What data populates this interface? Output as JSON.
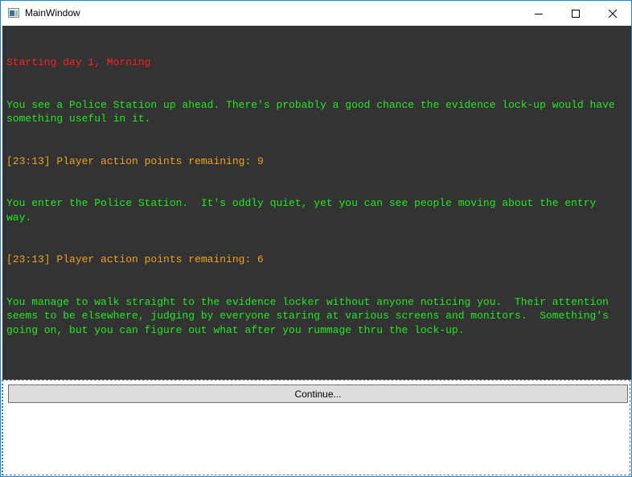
{
  "window": {
    "title": "MainWindow",
    "accent_color": "#1883d7"
  },
  "titlebar_buttons": [
    {
      "name": "minimize",
      "icon": "minimize-icon"
    },
    {
      "name": "maximize",
      "icon": "maximize-icon"
    },
    {
      "name": "close",
      "icon": "close-icon"
    }
  ],
  "log": {
    "background": "#333333",
    "lines": [
      {
        "type": "header",
        "color": "#ff2020",
        "text": "Starting day 1, Morning"
      },
      {
        "type": "narration",
        "color": "#22e822",
        "text": "You see a Police Station up ahead. There's probably a good chance the evidence lock-up would have something useful in it."
      },
      {
        "type": "status",
        "color": "#f0a020",
        "text": "[23:13] Player action points remaining: 9"
      },
      {
        "type": "narration",
        "color": "#22e822",
        "text": "You enter the Police Station.  It's oddly quiet, yet you can see people moving about the entry way."
      },
      {
        "type": "status",
        "color": "#f0a020",
        "text": "[23:13] Player action points remaining: 6"
      },
      {
        "type": "narration",
        "color": "#22e822",
        "text": "You manage to walk straight to the evidence locker without anyone noticing you.  Their attention seems to be elsewhere, judging by everyone staring at various screens and monitors.  Something's going on, but you can figure out what after you rummage thru the lock-up."
      }
    ]
  },
  "actions": {
    "continue_label": "Continue..."
  }
}
